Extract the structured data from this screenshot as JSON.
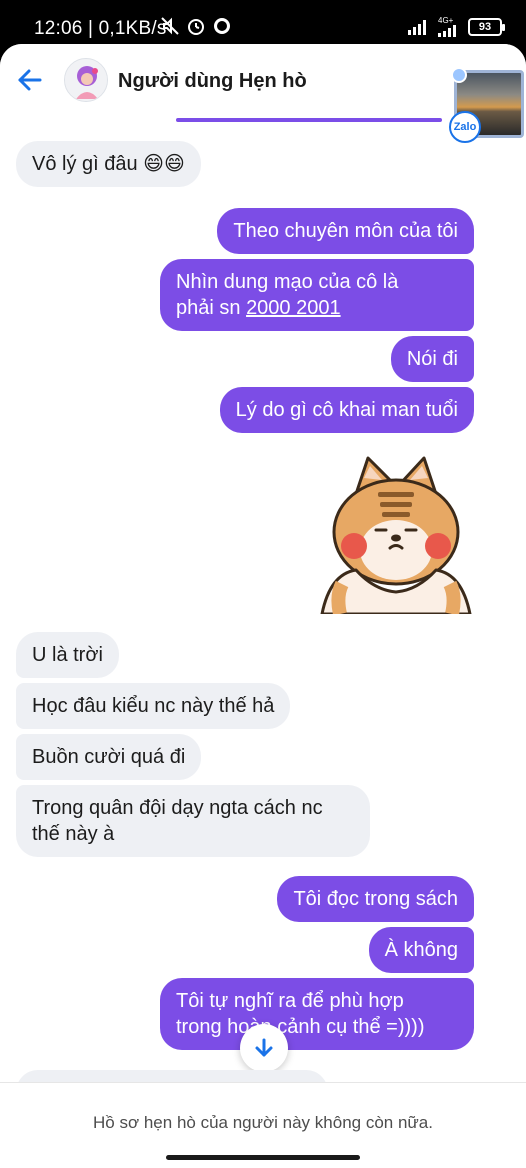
{
  "status_bar": {
    "time_speed": "12:06 | 0,1KB/s",
    "network": "4G+",
    "battery": "93"
  },
  "header": {
    "title": "Người dùng Hẹn hò",
    "thumbnail_badge": "Zalo"
  },
  "messages": [
    {
      "side": "in",
      "text": "Vô lý gì đâu 😄😄"
    },
    {
      "side": "out",
      "text": "Theo chuyên môn của tôi"
    },
    {
      "side": "out",
      "text_line1": "Nhìn dung mạo của cô là",
      "text_line2_prefix": "phải sn ",
      "text_line2_link": "2000 2001"
    },
    {
      "side": "out",
      "text": "Nói đi"
    },
    {
      "side": "out",
      "text": "Lý do gì cô khai man tuổi"
    },
    {
      "side": "out",
      "type": "sticker",
      "icon": "shiba-dog-sticker"
    },
    {
      "side": "in",
      "text": "U là trời"
    },
    {
      "side": "in",
      "text": "Học đâu kiểu nc này thế hả"
    },
    {
      "side": "in",
      "text": "Buồn cười quá đi"
    },
    {
      "side": "in",
      "text_line1": "Trong quân đội dạy ngta cách nc",
      "text_line2": "thế này à"
    },
    {
      "side": "out",
      "text": "Tôi đọc trong sách"
    },
    {
      "side": "out",
      "text": "À không"
    },
    {
      "side": "out",
      "text_line1": "Tôi tự nghĩ ra để phù hợp",
      "text_line2": "trong hoàn cảnh cụ thể =))))"
    }
  ],
  "footer": {
    "notice": "Hồ sơ hẹn hò của người này không còn nữa."
  },
  "colors": {
    "accent": "#7c4de6",
    "incoming_bubble": "#eef0f4",
    "back_arrow": "#1a73e8"
  }
}
